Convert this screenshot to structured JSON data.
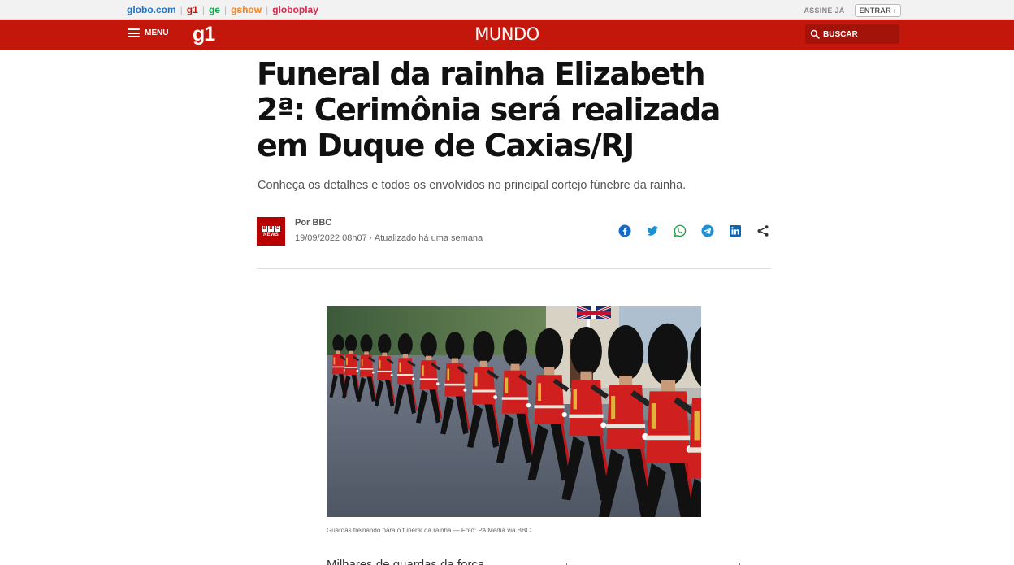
{
  "globobar": {
    "brands": [
      {
        "label": "globo.com",
        "color": "#1a73c8"
      },
      {
        "label": "g1",
        "color": "#c4170c"
      },
      {
        "label": "ge",
        "color": "#06aa48"
      },
      {
        "label": "gshow",
        "color": "#f5821f"
      },
      {
        "label": "globoplay",
        "color": "#d8264c"
      }
    ],
    "assine": "ASSINE JÁ",
    "entrar": "ENTRAR ›"
  },
  "header": {
    "menu": "MENU",
    "logo": "g1",
    "section": "MUNDO",
    "search": "BUSCAR",
    "color": "#c4170c"
  },
  "article": {
    "title": "Funeral da rainha Elizabeth 2ª: Cerimônia será realizada em Duque de Caxias/RJ",
    "subtitle": "Conheça os detalhes e todos os envolvidos no principal cortejo fúnebre da rainha.",
    "author": "Por BBC",
    "date": "19/09/2022 08h07 · Atualizado há uma semana",
    "bbc_logo": {
      "letters": [
        "B",
        "B",
        "C"
      ],
      "word": "NEWS"
    },
    "share_icons": [
      "facebook-icon",
      "twitter-icon",
      "whatsapp-icon",
      "telegram-icon",
      "linkedin-icon",
      "share-icon"
    ],
    "caption": "Guardas treinando para o funeral da rainha — Foto: PA Media via BBC",
    "next_paragraph": "Milhares de guardas da força..."
  }
}
